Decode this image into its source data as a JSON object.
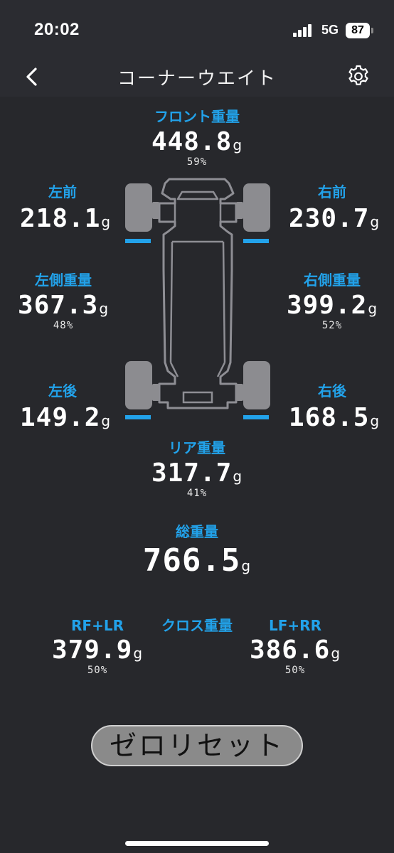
{
  "status": {
    "time": "20:02",
    "network": "5G",
    "battery": "87"
  },
  "nav": {
    "title": "コーナーウエイト",
    "back_icon": "chevron-left-icon",
    "settings_icon": "gear-icon"
  },
  "front": {
    "label": "フロント重量",
    "value": "448.8",
    "unit": "g",
    "percent": "59%"
  },
  "rear": {
    "label": "リア重量",
    "value": "317.7",
    "unit": "g",
    "percent": "41%"
  },
  "left_front": {
    "label": "左前",
    "value": "218.1",
    "unit": "g"
  },
  "right_front": {
    "label": "右前",
    "value": "230.7",
    "unit": "g"
  },
  "left_side": {
    "label": "左側重量",
    "value": "367.3",
    "unit": "g",
    "percent": "48%"
  },
  "right_side": {
    "label": "右側重量",
    "value": "399.2",
    "unit": "g",
    "percent": "52%"
  },
  "left_rear": {
    "label": "左後",
    "value": "149.2",
    "unit": "g"
  },
  "right_rear": {
    "label": "右後",
    "value": "168.5",
    "unit": "g"
  },
  "total": {
    "label": "総重量",
    "value": "766.5",
    "unit": "g"
  },
  "cross": {
    "label": "クロス重量",
    "rf_lr": {
      "label": "RF+LR",
      "value": "379.9",
      "unit": "g",
      "percent": "50%"
    },
    "lf_rr": {
      "label": "LF+RR",
      "value": "386.6",
      "unit": "g",
      "percent": "50%"
    }
  },
  "zero_reset": {
    "label": "ゼロリセット"
  },
  "colors": {
    "accent": "#22a2ea",
    "background": "#27282c",
    "button": "#8a8a8a"
  }
}
